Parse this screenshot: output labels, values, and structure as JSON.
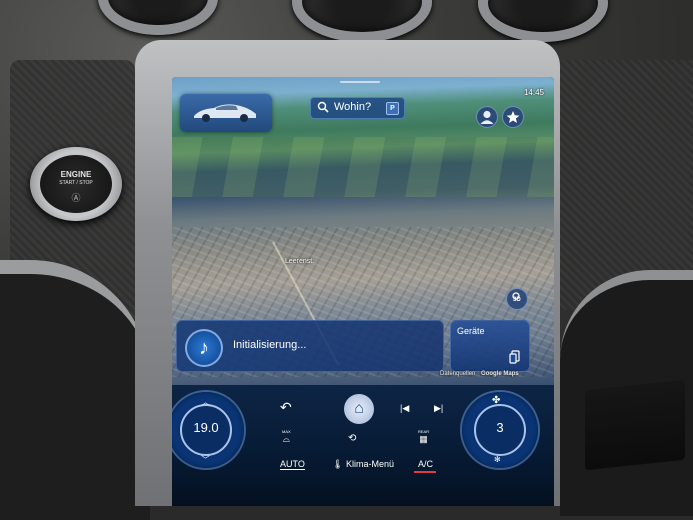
{
  "console": {
    "engine_button": {
      "line1": "ENGINE",
      "line2": "START / STOP",
      "glyph": "Ⓐ"
    }
  },
  "status_bar": {
    "time": "14:45"
  },
  "navigation": {
    "search_label": "Wohin?",
    "parking_badge": "P",
    "street_label": "Leerenst.",
    "view_toggle_label": "3D",
    "data_sources_label": "Datenquellen",
    "map_provider_label": "Google Maps"
  },
  "media": {
    "status": "Initialisierung..."
  },
  "devices": {
    "label": "Geräte"
  },
  "climate": {
    "temperature": "19.0",
    "fan_level": "3",
    "front_defrost_label": "MAX",
    "rear_defrost_label": "REAR",
    "auto_label": "AUTO",
    "climate_menu_label": "Klima-Menü",
    "ac_label": "A/C",
    "ac_indicator_color": "#e03a3a"
  },
  "icons": [
    "search-icon",
    "parking-icon",
    "profile-icon",
    "favorites-star-icon",
    "3d-view-icon",
    "music-note-icon",
    "device-icon",
    "chevron-up-icon",
    "chevron-down-icon",
    "back-icon",
    "home-icon",
    "previous-track-icon",
    "next-track-icon",
    "front-defrost-icon",
    "recirculation-icon",
    "rear-defrost-icon",
    "thermometer-icon",
    "fan-icon"
  ],
  "colors": {
    "screen_background": "#061322",
    "ui_blue": "#22497c",
    "accent_red": "#e03a3a"
  }
}
